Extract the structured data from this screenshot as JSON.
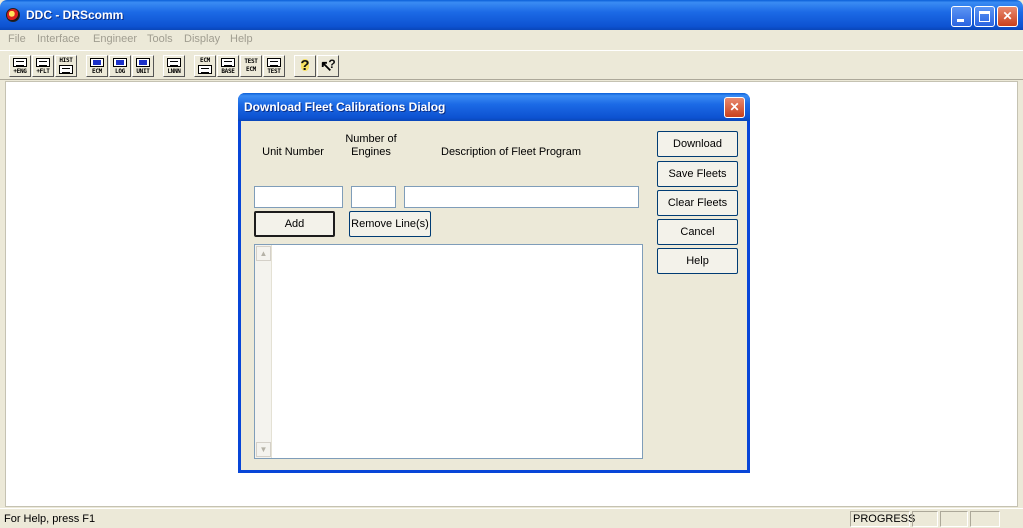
{
  "window": {
    "title": "DDC - DRScomm"
  },
  "menu": {
    "items": [
      "File",
      "Interface",
      "Engineer",
      "Tools",
      "Display",
      "Help"
    ]
  },
  "toolbar": {
    "buttons": [
      {
        "cap": "+ENG",
        "icon": "engine-icon"
      },
      {
        "cap": "+FLT",
        "icon": "fleet-icon"
      },
      {
        "cap": "HIST",
        "icon": "history-icon"
      },
      {
        "cap": "ECM",
        "icon": "ecm-icon"
      },
      {
        "cap": "LOG",
        "icon": "log-icon"
      },
      {
        "cap": "UNIT",
        "icon": "unit-icon"
      },
      {
        "cap": "LNNN",
        "icon": "printer-icon"
      },
      {
        "cap": "ECM",
        "icon": "ecm-upload-icon"
      },
      {
        "cap": "BASE",
        "icon": "base-icon"
      },
      {
        "cap": "TEST ECM",
        "icon": "test-ecm-icon"
      },
      {
        "cap": "TEST",
        "icon": "test-icon"
      },
      {
        "cap": "?",
        "icon": "help-icon"
      },
      {
        "cap": "?",
        "icon": "context-help-icon"
      }
    ]
  },
  "dialog": {
    "title": "Download Fleet Calibrations Dialog",
    "col_unit": "Unit Number",
    "col_engines": "Number of Engines",
    "col_description": "Description of Fleet Program",
    "unit_value": "",
    "engines_value": "",
    "description_value": "",
    "add_label": "Add",
    "remove_label": "Remove Line(s)",
    "download_label": "Download",
    "save_label": "Save Fleets",
    "clear_label": "Clear Fleets",
    "cancel_label": "Cancel",
    "help_label": "Help"
  },
  "status": {
    "text": "For Help, press F1",
    "progress_label": "PROGRESS"
  }
}
